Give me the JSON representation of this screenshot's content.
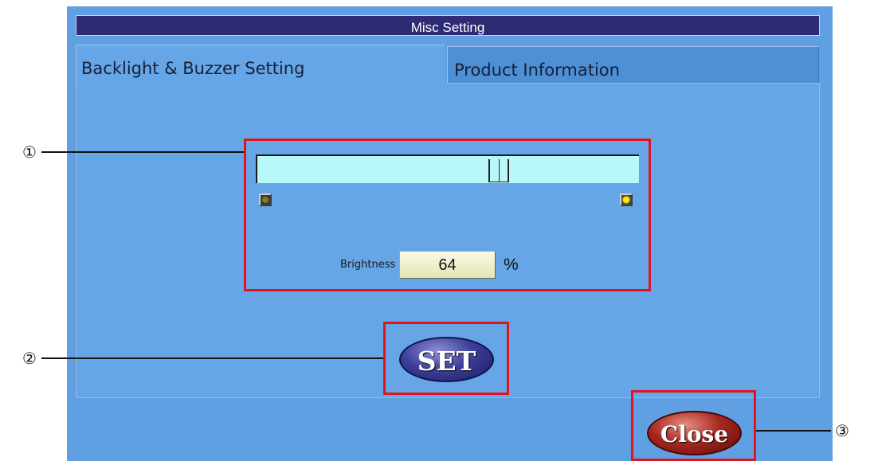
{
  "window": {
    "title": "Misc Setting"
  },
  "tabs": [
    {
      "label": "Backlight & Buzzer Setting",
      "active": true
    },
    {
      "label": "Product Information",
      "active": false
    }
  ],
  "brightness": {
    "slider_value_percent": 64,
    "min_indicator": "dim-lamp-icon",
    "max_indicator": "bright-lamp-icon",
    "label": "Brightness",
    "value": "64",
    "unit": "%"
  },
  "buttons": {
    "set_label": "SET",
    "close_label": "Close"
  },
  "callouts": [
    "①",
    "②",
    "③"
  ],
  "colors": {
    "panel": "#5f9fe2",
    "title_bar": "#2e2a73",
    "slider_track": "#b8f7fa",
    "highlight_box": "#e0141c",
    "set_button": "#2f3187",
    "close_button": "#8e1a12"
  }
}
